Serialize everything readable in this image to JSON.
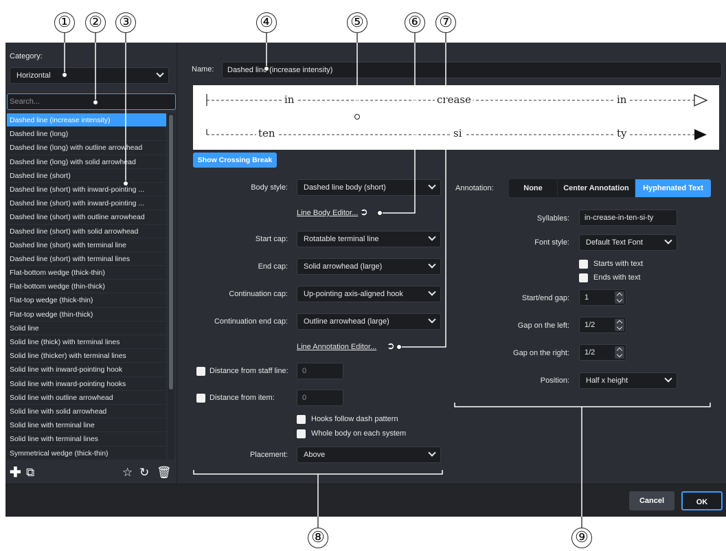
{
  "callouts": [
    "①",
    "②",
    "③",
    "④",
    "⑤",
    "⑥",
    "⑦",
    "⑧",
    "⑨"
  ],
  "left": {
    "category_label": "Category:",
    "category_value": "Horizontal",
    "search_placeholder": "Search...",
    "items": [
      "Dashed line (increase intensity)",
      "Dashed line (long)",
      "Dashed line (long) with outline arrowhead",
      "Dashed line (long) with solid arrowhead",
      "Dashed line (short)",
      "Dashed line (short) with inward-pointing ...",
      "Dashed line (short) with inward-pointing ...",
      "Dashed line (short) with outline arrowhead",
      "Dashed line (short) with solid arrowhead",
      "Dashed line (short) with terminal line",
      "Dashed line (short) with terminal lines",
      "Flat-bottom wedge (thick-thin)",
      "Flat-bottom wedge (thin-thick)",
      "Flat-top wedge (thick-thin)",
      "Flat-top wedge (thin-thick)",
      "Solid line",
      "Solid line (thick) with terminal lines",
      "Solid line (thicker) with terminal lines",
      "Solid line with inward-pointing hook",
      "Solid line with inward-pointing hooks",
      "Solid line with outline arrowhead",
      "Solid line with solid arrowhead",
      "Solid line with terminal line",
      "Solid line with terminal lines",
      "Symmetrical wedge (thick-thin)"
    ]
  },
  "header": {
    "name_label": "Name:",
    "name_value": "Dashed line (increase intensity)"
  },
  "preview": {
    "row1": [
      "in",
      "crease",
      "in"
    ],
    "row2": [
      "ten",
      "si",
      "ty"
    ]
  },
  "crossing_break": "Show Crossing Break",
  "form": {
    "body_style_label": "Body style:",
    "body_style_value": "Dashed line body (short)",
    "line_body_editor": "Line Body Editor...",
    "start_cap_label": "Start cap:",
    "start_cap_value": "Rotatable terminal line",
    "end_cap_label": "End cap:",
    "end_cap_value": "Solid arrowhead (large)",
    "continuation_cap_label": "Continuation cap:",
    "continuation_cap_value": "Up-pointing axis-aligned hook",
    "continuation_end_cap_label": "Continuation end cap:",
    "continuation_end_cap_value": "Outline arrowhead (large)",
    "line_annotation_editor": "Line Annotation Editor...",
    "distance_staff_label": "Distance from staff line:",
    "distance_staff_value": "0",
    "distance_item_label": "Distance from item:",
    "distance_item_value": "0",
    "hooks_follow": "Hooks follow dash pattern",
    "whole_body": "Whole body on each system",
    "placement_label": "Placement:",
    "placement_value": "Above"
  },
  "annotation": {
    "label": "Annotation:",
    "options": [
      "None",
      "Center Annotation",
      "Hyphenated Text"
    ],
    "syllables_label": "Syllables:",
    "syllables_value": "in-crease-in-ten-si-ty",
    "font_style_label": "Font style:",
    "font_style_value": "Default Text Font",
    "starts_with_text": "Starts with text",
    "ends_with_text": "Ends with text",
    "start_end_gap_label": "Start/end gap:",
    "start_end_gap_value": "1",
    "gap_left_label": "Gap on the left:",
    "gap_left_value": "1/2",
    "gap_right_label": "Gap on the right:",
    "gap_right_value": "1/2",
    "position_label": "Position:",
    "position_value": "Half x height"
  },
  "footer": {
    "cancel": "Cancel",
    "ok": "OK"
  },
  "colors": {
    "accent": "#3b9cff",
    "panel": "#2b2e34",
    "field": "#1b1d21"
  }
}
